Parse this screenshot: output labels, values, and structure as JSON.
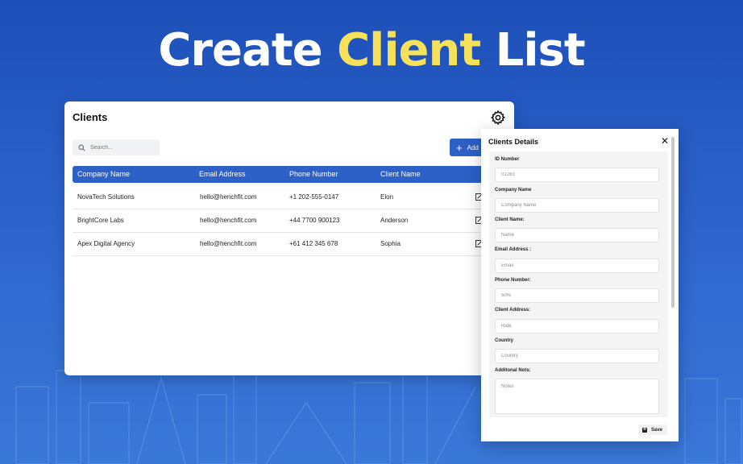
{
  "hero": {
    "title_part1": "Create",
    "title_accent": "Client",
    "title_part2": "List"
  },
  "colors": {
    "accent": "#f6e25a",
    "primary": "#2d61c8",
    "background": "#1d4fb8"
  },
  "clients_card": {
    "title": "Clients",
    "search": {
      "placeholder": "Search..."
    },
    "add_button": {
      "label": "Add"
    },
    "columns": [
      "Company Name",
      "Email Address",
      "Phone Number",
      "Client Name"
    ],
    "rows": [
      {
        "company": "NovaTech Solutions",
        "email": "hello@henchfit.com",
        "phone": "+1 202-555-0147",
        "client": "Elon"
      },
      {
        "company": "BrightCore Labs",
        "email": "hello@henchfit.com",
        "phone": "+44 7700 900123",
        "client": "Anderson"
      },
      {
        "company": "Apex Digital Agency",
        "email": "hello@henchfit.com",
        "phone": "+61 412 345 678",
        "client": "Sophia"
      }
    ]
  },
  "details_panel": {
    "title": "Clients Details",
    "fields": [
      {
        "label": "ID Number",
        "placeholder": "01283"
      },
      {
        "label": "Company Name",
        "placeholder": "Company Name"
      },
      {
        "label": "Client Name:",
        "placeholder": "Name"
      },
      {
        "label": "Email Address :",
        "placeholder": "Email"
      },
      {
        "label": "Phone Number:",
        "placeholder": "50%"
      },
      {
        "label": "Client Address:",
        "placeholder": "Rate"
      },
      {
        "label": "Country",
        "placeholder": "Country"
      },
      {
        "label": "Additonal Nots:",
        "placeholder": "Notes"
      }
    ],
    "save_label": "Save"
  },
  "icons": [
    "search-icon",
    "gear-icon",
    "plus-icon",
    "edit-icon",
    "close-icon",
    "save-icon"
  ]
}
